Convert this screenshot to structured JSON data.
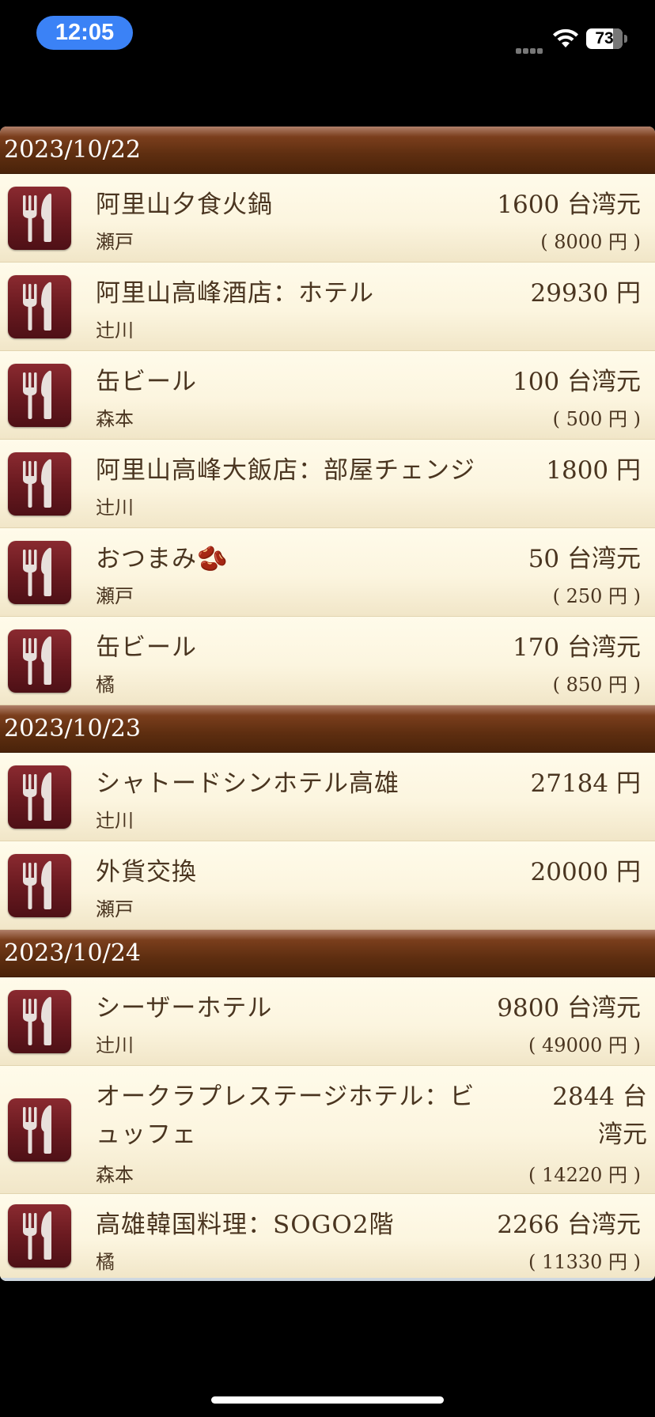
{
  "status_bar": {
    "time": "12:05",
    "battery_percent": 73,
    "battery_label": "73"
  },
  "sections": [
    {
      "date": "2023/10/22",
      "rows": [
        {
          "title": "阿里山夕食火鍋",
          "person": "瀬戸",
          "amount": "1600 台湾元",
          "yen": "( 8000 円 )",
          "icon": "fork-knife-icon"
        },
        {
          "title": "阿里山高峰酒店：ホテル",
          "person": "辻川",
          "amount": "29930 円",
          "yen": "",
          "icon": "fork-knife-icon"
        },
        {
          "title": "缶ビール",
          "person": "森本",
          "amount": "100 台湾元",
          "yen": "( 500 円 )",
          "icon": "fork-knife-icon"
        },
        {
          "title": "阿里山高峰大飯店：部屋チェンジ",
          "person": "辻川",
          "amount": "1800 円",
          "yen": "",
          "icon": "fork-knife-icon"
        },
        {
          "title": "おつまみ🫘",
          "person": "瀬戸",
          "amount": "50 台湾元",
          "yen": "( 250 円 )",
          "icon": "fork-knife-icon"
        },
        {
          "title": "缶ビール",
          "person": "橘",
          "amount": "170 台湾元",
          "yen": "( 850 円 )",
          "icon": "fork-knife-icon"
        }
      ]
    },
    {
      "date": "2023/10/23",
      "rows": [
        {
          "title": "シャトードシンホテル高雄",
          "person": "辻川",
          "amount": "27184 円",
          "yen": "",
          "icon": "fork-knife-icon"
        },
        {
          "title": "外貨交換",
          "person": "瀬戸",
          "amount": "20000 円",
          "yen": "",
          "icon": "fork-knife-icon"
        }
      ]
    },
    {
      "date": "2023/10/24",
      "rows": [
        {
          "title": "シーザーホテル",
          "person": "辻川",
          "amount": "9800 台湾元",
          "yen": "( 49000 円 )",
          "icon": "fork-knife-icon"
        },
        {
          "title": "オークラプレステージホテル：ビュッフェ",
          "person": "森本",
          "amount": "2844 台湾元",
          "yen": "( 14220 円 )",
          "icon": "fork-knife-icon"
        },
        {
          "title": "高雄韓国料理：SOGO2階",
          "person": "橘",
          "amount": "2266 台湾元",
          "yen": "( 11330 円 )",
          "icon": "fork-knife-icon"
        }
      ]
    }
  ],
  "colors": {
    "header_brown": "#5e2e10",
    "row_cream": "#fcf5df",
    "icon_maroon": "#6a1a20",
    "text_brown": "#4a3520"
  }
}
